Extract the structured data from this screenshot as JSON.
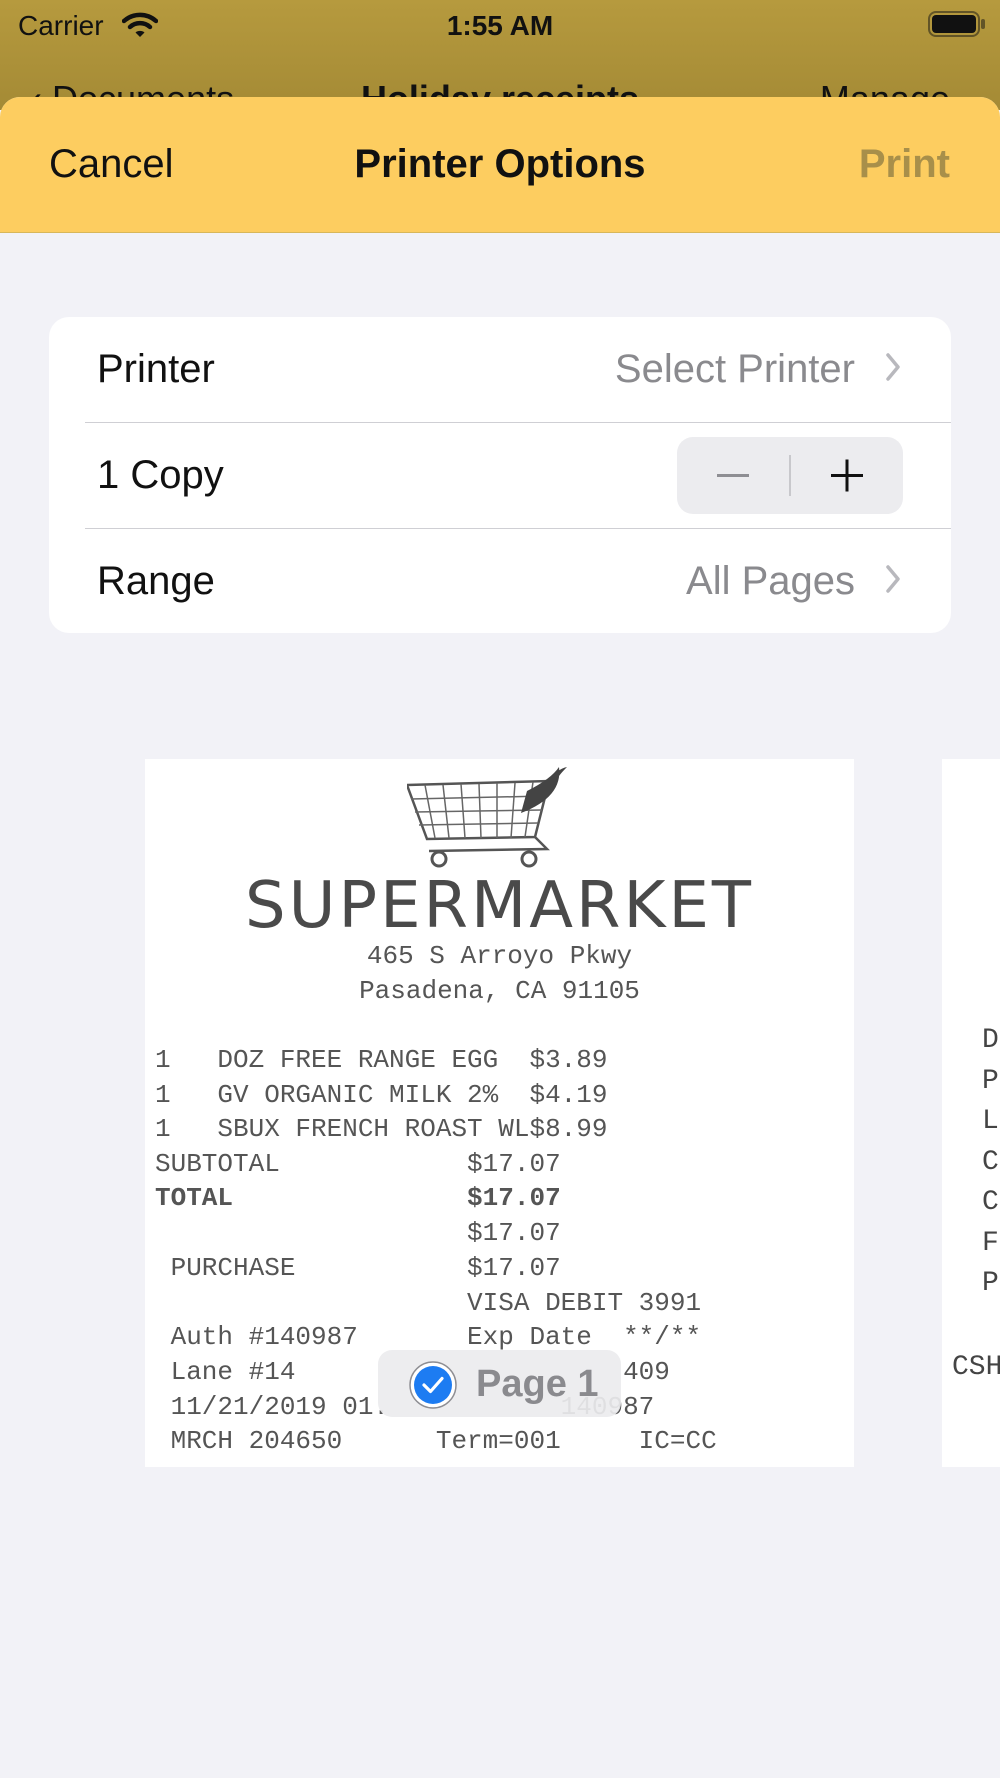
{
  "status": {
    "carrier": "Carrier",
    "time": "1:55 AM"
  },
  "background_nav": {
    "back_label": "Documents",
    "title": "Holiday receipts",
    "manage_label": "Manage"
  },
  "sheet": {
    "cancel_label": "Cancel",
    "title": "Printer Options",
    "print_label": "Print"
  },
  "options": {
    "printer_label": "Printer",
    "printer_value": "Select Printer",
    "copies_label": "1 Copy",
    "range_label": "Range",
    "range_value": "All Pages"
  },
  "receipt": {
    "store_name": "SUPERMARKET",
    "address1": "465 S Arroyo Pkwy",
    "address2": "Pasadena, CA 91105",
    "lines": [
      "1   DOZ FREE RANGE EGG  $3.89",
      "1   GV ORGANIC MILK 2%  $4.19",
      "1   SBUX FRENCH ROAST WL$8.99",
      "SUBTOTAL            $17.07",
      "TOTAL               $17.07",
      "                    $17.07",
      " PURCHASE           $17.07",
      "                    VISA DEBIT 3991",
      " Auth #140987       Exp Date  **/**",
      " Lane #14                     409",
      " 11/21/2019 01.           140987",
      " MRCH 204650      Term=001     IC=CC"
    ]
  },
  "page2": {
    "letters": [
      "D",
      "P",
      "L",
      "C",
      "C",
      "F",
      "P"
    ],
    "csh": "CSH"
  },
  "page_badge": {
    "label": "Page 1"
  },
  "colors": {
    "accent_yellow": "#fdcd60",
    "status_bar": "#b69a3e",
    "check_blue": "#1d7cf2",
    "print_disabled": "#a88f4a"
  }
}
